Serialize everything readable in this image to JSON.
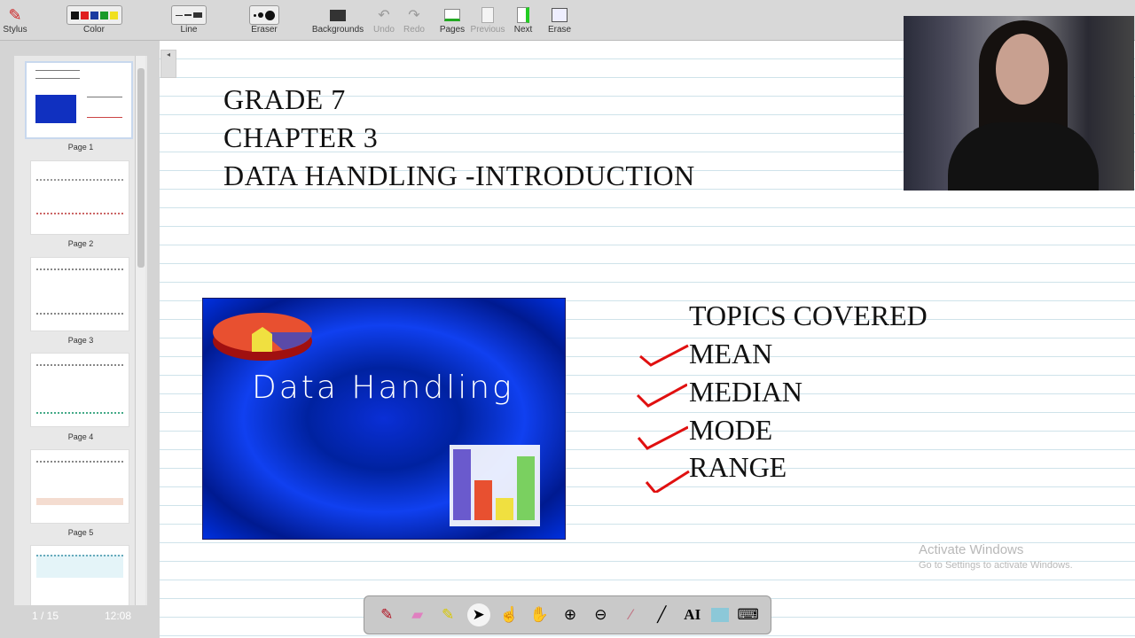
{
  "toolbar": {
    "stylus": "Stylus",
    "color": "Color",
    "line": "Line",
    "eraser": "Eraser",
    "backgrounds": "Backgrounds",
    "undo": "Undo",
    "redo": "Redo",
    "pages": "Pages",
    "previous": "Previous",
    "next": "Next",
    "erase": "Erase",
    "colors": [
      "#111111",
      "#e02020",
      "#1a3aa0",
      "#1a9a2a",
      "#f0e020"
    ]
  },
  "sidebar": {
    "pages": [
      "Page 1",
      "Page 2",
      "Page 3",
      "Page 4",
      "Page 5"
    ],
    "page_counter": "1 / 15",
    "time": "12:08"
  },
  "slide": {
    "line1": "GRADE 7",
    "line2": "CHAPTER 3",
    "line3": "DATA HANDLING -INTRODUCTION",
    "image_caption": "Data Handling",
    "topics_title": "TOPICS COVERED",
    "topics": [
      "MEAN",
      "MEDIAN",
      "MODE",
      "RANGE"
    ],
    "check_color": "#e01010"
  },
  "watermark": {
    "title": "Activate Windows",
    "subtitle": "Go to Settings to activate Windows."
  }
}
